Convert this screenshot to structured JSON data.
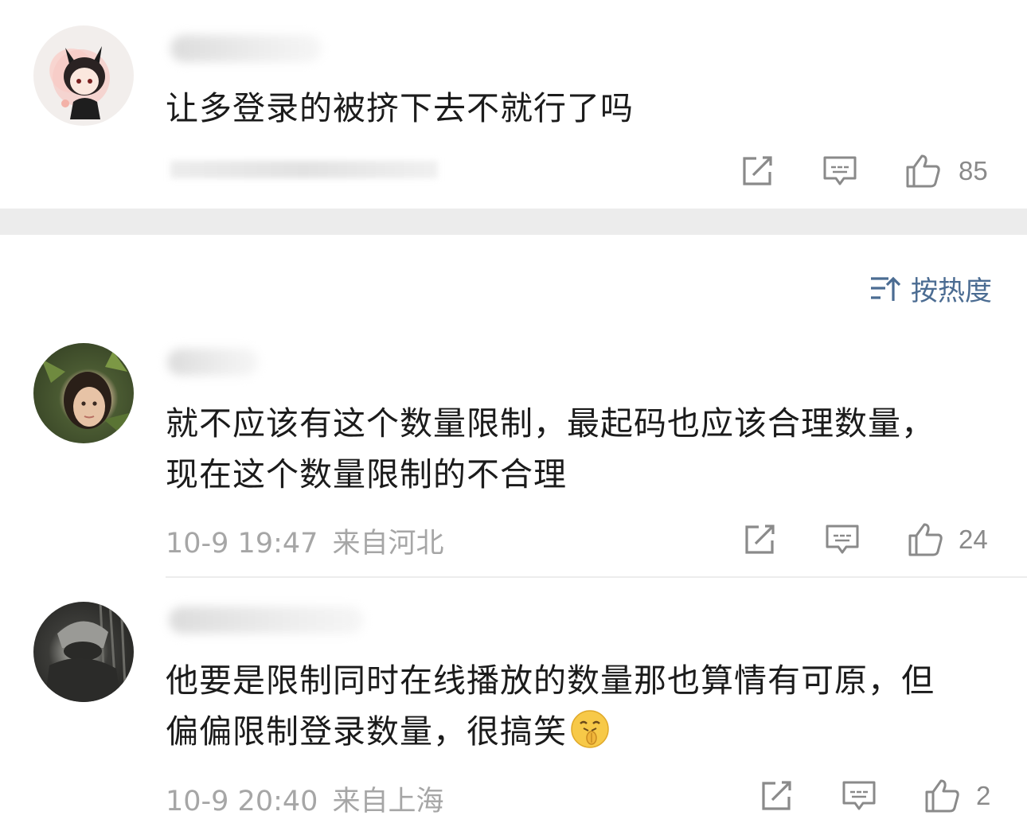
{
  "sort": {
    "label": "按热度"
  },
  "comments": [
    {
      "text_lines": [
        "让多登录的被挤下去不就行了吗"
      ],
      "likes": "85"
    },
    {
      "text_lines": [
        "就不应该有这个数量限制，最起码也应该合理数量，",
        "现在这个数量限制的不合理"
      ],
      "time": "10-9 19:47",
      "location": "来自河北",
      "likes": "24"
    },
    {
      "text_lines": [
        "他要是限制同时在线播放的数量那也算情有可原，但",
        "偏偏限制登录数量，很搞笑"
      ],
      "time": "10-9 20:40",
      "location": "来自上海",
      "likes": "2",
      "emoji": "shush-face-emoji"
    }
  ],
  "colors": {
    "link_blue": "#4b6c92",
    "meta_gray": "#a6a6a6",
    "text": "#1b1b1b"
  }
}
